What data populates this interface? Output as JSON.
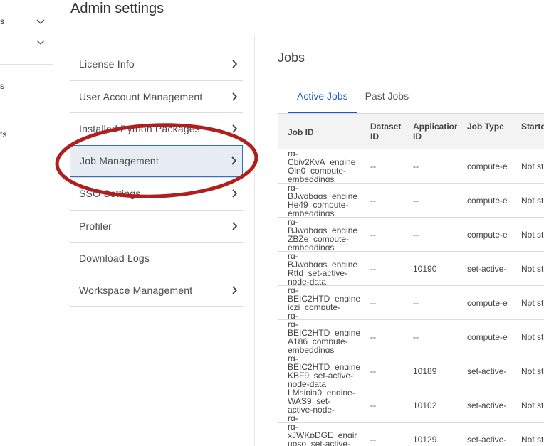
{
  "sidebar": {
    "items": [
      {
        "label": "s"
      },
      {
        "label": ""
      },
      {
        "label": "s"
      },
      {
        "label": "ts"
      }
    ]
  },
  "header": {
    "title": "Admin settings"
  },
  "menu": {
    "items": [
      {
        "label": "License Info",
        "chevron": true
      },
      {
        "label": "User Account Management",
        "chevron": true
      },
      {
        "label": "Installed Python Packages",
        "chevron": true
      },
      {
        "label": "Job Management",
        "chevron": true,
        "active": true
      },
      {
        "label": "SSO Settings",
        "chevron": true
      },
      {
        "label": "Profiler",
        "chevron": true
      },
      {
        "label": "Download Logs",
        "chevron": false
      },
      {
        "label": "Workspace Management",
        "chevron": true
      }
    ]
  },
  "jobs": {
    "title": "Jobs",
    "tabs": [
      {
        "label": "Active Jobs",
        "active": true
      },
      {
        "label": "Past Jobs",
        "active": false
      }
    ],
    "columns": [
      "Job ID",
      "Dataset ID",
      "Application ID",
      "Job Type",
      "Started"
    ],
    "rows": [
      {
        "id_lines": [
          "rq-",
          "Cbjv2KyA_engine",
          "Oln0_compute-",
          "embeddings"
        ],
        "dataset": "--",
        "app": "--",
        "type": "compute-e",
        "started": "Not st"
      },
      {
        "id_lines": [
          "rq-",
          "BJwgbqgs_engine",
          "He49_compute-",
          "embeddings"
        ],
        "dataset": "--",
        "app": "--",
        "type": "compute-e",
        "started": "Not st"
      },
      {
        "id_lines": [
          "rq-",
          "BJwgbqgs_engine",
          "ZBZe_compute-",
          "embeddings"
        ],
        "dataset": "--",
        "app": "--",
        "type": "compute-e",
        "started": "Not st"
      },
      {
        "id_lines": [
          "rq-",
          "BJwgbqgs_engine",
          "Rttd_set-active-",
          "node-data"
        ],
        "dataset": "--",
        "app": "10190",
        "type": "set-active-",
        "started": "Not st"
      },
      {
        "id_lines": [
          "rq-",
          "BEIC2HTD_engine",
          "jczi_compute-",
          "rq-"
        ],
        "dataset": "--",
        "app": "--",
        "type": "compute-e",
        "started": "Not st"
      },
      {
        "id_lines": [
          "rq-",
          "BEIC2HTD_engine",
          "A186_compute-",
          "embeddings"
        ],
        "dataset": "--",
        "app": "--",
        "type": "compute-e",
        "started": "Not st"
      },
      {
        "id_lines": [
          "rq-",
          "BEIC2HTD_engine",
          "KBF9_set-active-",
          "node-data"
        ],
        "dataset": "--",
        "app": "10189",
        "type": "set-active-",
        "started": "Not st"
      },
      {
        "id_lines": [
          "LMsjpja0_engine-",
          "WAS9_set-",
          "active-node-",
          "rq-"
        ],
        "dataset": "--",
        "app": "10102",
        "type": "set-active-",
        "started": "Not st"
      },
      {
        "id_lines": [
          "rq-",
          "xJWKpDGE_engir",
          "upso_set-active-",
          ""
        ],
        "dataset": "--",
        "app": "10129",
        "type": "set-active-",
        "started": "Not st"
      }
    ]
  },
  "colors": {
    "accent": "#1a5cc8",
    "active_bg": "#e8ecf3",
    "annotation": "#b01e1e"
  },
  "icons": {
    "menu_chevron": "chevron-right-icon",
    "sidebar_chevron": "chevron-down-icon"
  }
}
